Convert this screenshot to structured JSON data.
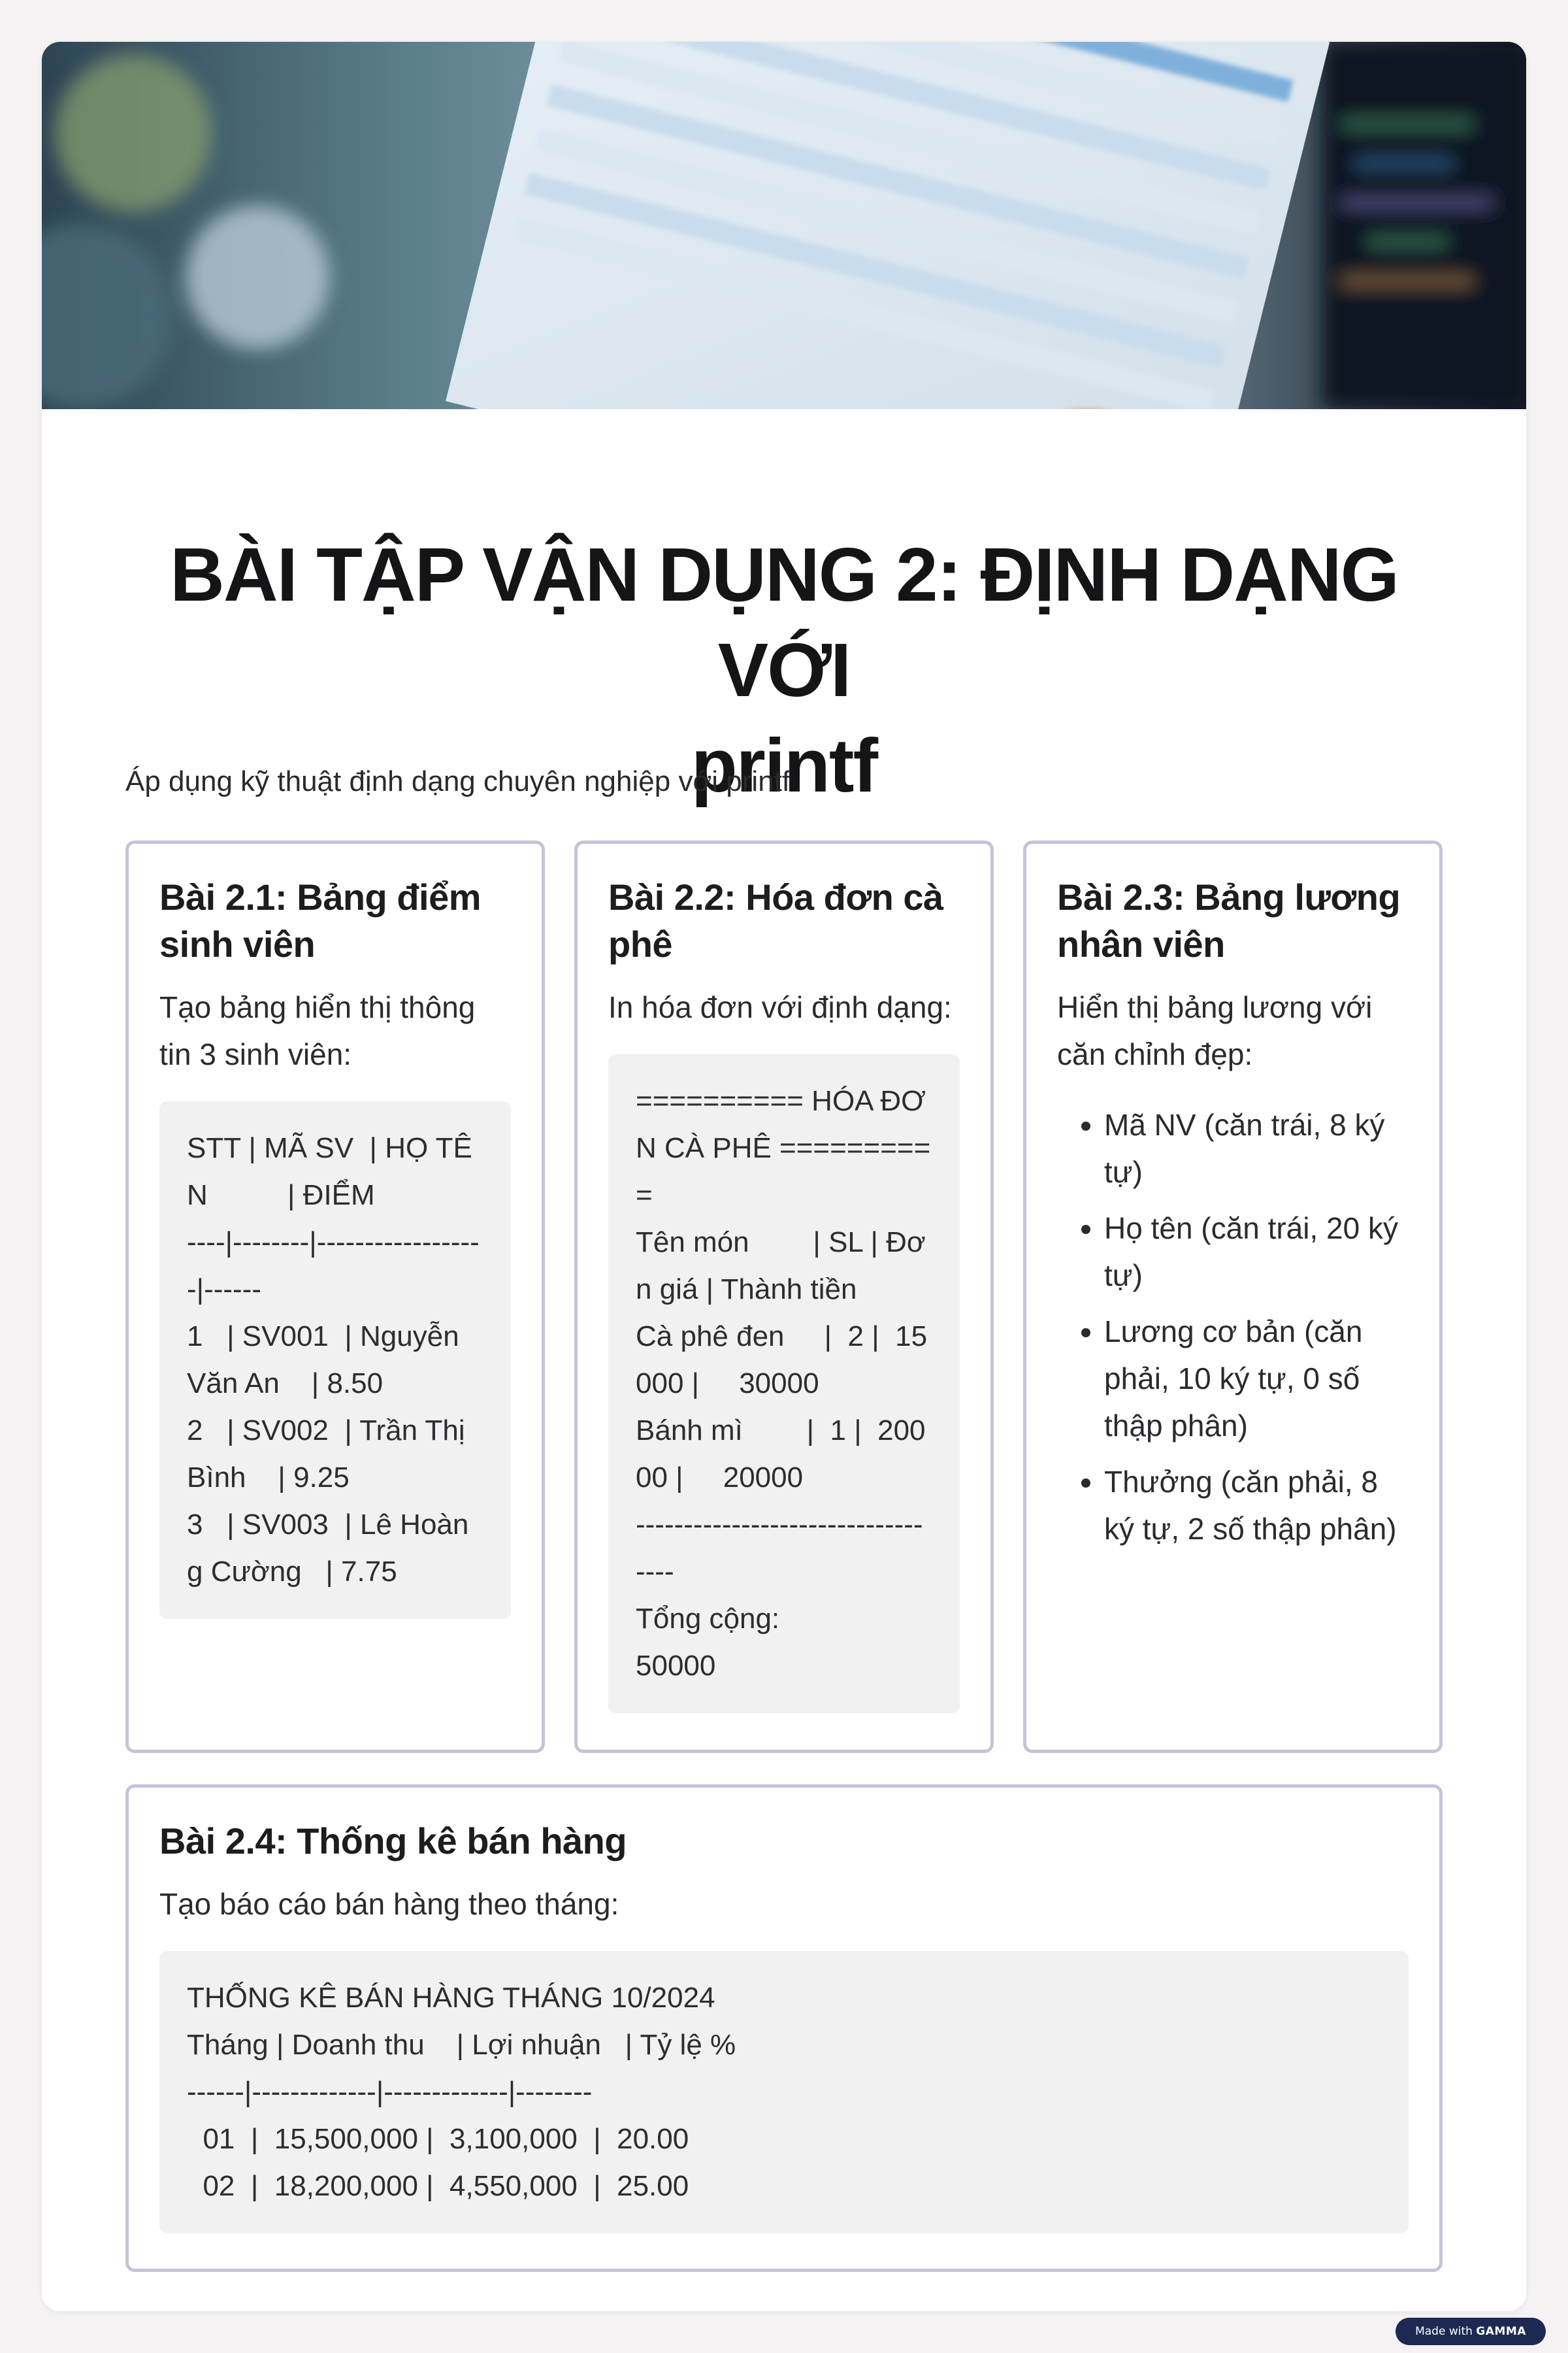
{
  "hero": {
    "image_description_icon": "photo-document-table-icon"
  },
  "header": {
    "title_line1": "BÀI TẬP VẬN DỤNG 2: ĐỊNH DẠNG VỚI",
    "title_line2": "printf",
    "subtitle": "Áp dụng kỹ thuật định dạng chuyên nghiệp với printf"
  },
  "exercises": [
    {
      "title": "Bài 2.1: Bảng điểm sinh viên",
      "description": "Tạo bảng hiển thị thông tin 3 sinh viên:",
      "code": "STT | MÃ SV  | HỌ TÊN          | ĐIỂM\n----|--------|------------------|------\n1   | SV001  | Nguyễn Văn An    | 8.50\n2   | SV002  | Trần Thị Bình    | 9.25\n3   | SV003  | Lê Hoàng Cường   | 7.75"
    },
    {
      "title": "Bài 2.2: Hóa đơn cà phê",
      "description": "In hóa đơn với định dạng:",
      "code": "========== HÓA ĐƠN CÀ PHÊ ==========\nTên món        | SL | Đơn giá | Thành tiền\nCà phê đen     |  2 |  15000 |     30000\nBánh mì        |  1 |  20000 |     20000\n----------------------------------\nTổng cộng:                      50000"
    },
    {
      "title": "Bài 2.3: Bảng lương nhân viên",
      "description": "Hiển thị bảng lương với căn chỉnh đẹp:",
      "bullets": [
        "Mã NV (căn trái, 8 ký tự)",
        "Họ tên (căn trái, 20 ký tự)",
        "Lương cơ bản (căn phải, 10 ký tự, 0 số thập phân)",
        "Thưởng (căn phải, 8 ký tự, 2 số thập phân)"
      ]
    },
    {
      "title": "Bài 2.4: Thống kê bán hàng",
      "description": "Tạo báo cáo bán hàng theo tháng:",
      "code": "THỐNG KÊ BÁN HÀNG THÁNG 10/2024\nTháng | Doanh thu    | Lợi nhuận   | Tỷ lệ %\n------|-------------|-------------|--------\n  01  |  15,500,000 |  3,100,000  |  20.00\n  02  |  18,200,000 |  4,550,000  |  25.00"
    }
  ],
  "footer": {
    "badge_prefix": "Made with",
    "badge_brand": "GAMMA"
  }
}
